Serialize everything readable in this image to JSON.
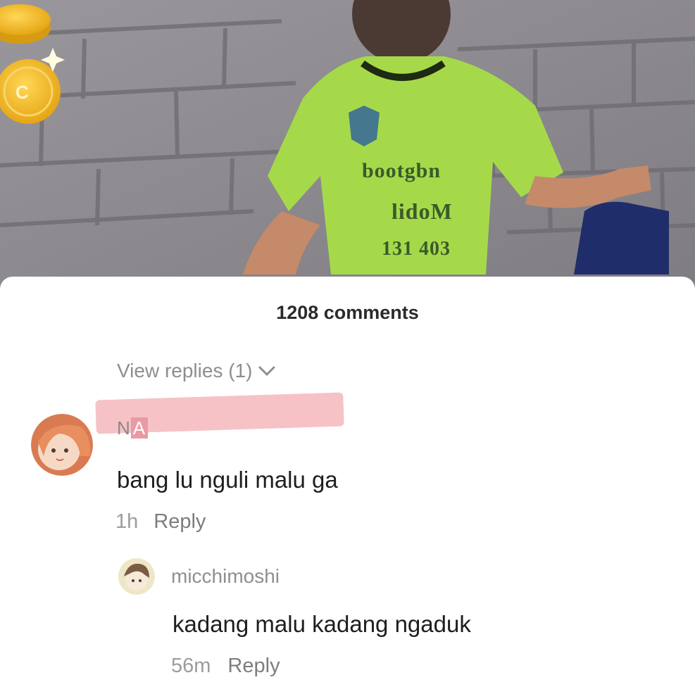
{
  "video": {
    "jersey_lines": [
      "bootgbn",
      "lidoM",
      "131 403"
    ],
    "colors": {
      "wall": "#8d8a8e",
      "jersey": "#a6d94a",
      "coin": "#f2b92a"
    }
  },
  "comments_panel": {
    "count_label": "1208 comments",
    "view_replies_label": "View replies (1)",
    "comments": [
      {
        "username_part1": "N",
        "username_part2": "A",
        "text": "bang lu nguli malu ga",
        "time": "1h",
        "reply_label": "Reply"
      },
      {
        "username": "micchimoshi",
        "text": "kadang malu kadang ngaduk",
        "time": "56m",
        "reply_label": "Reply"
      }
    ],
    "icons": [
      "chevron-down-icon"
    ]
  }
}
